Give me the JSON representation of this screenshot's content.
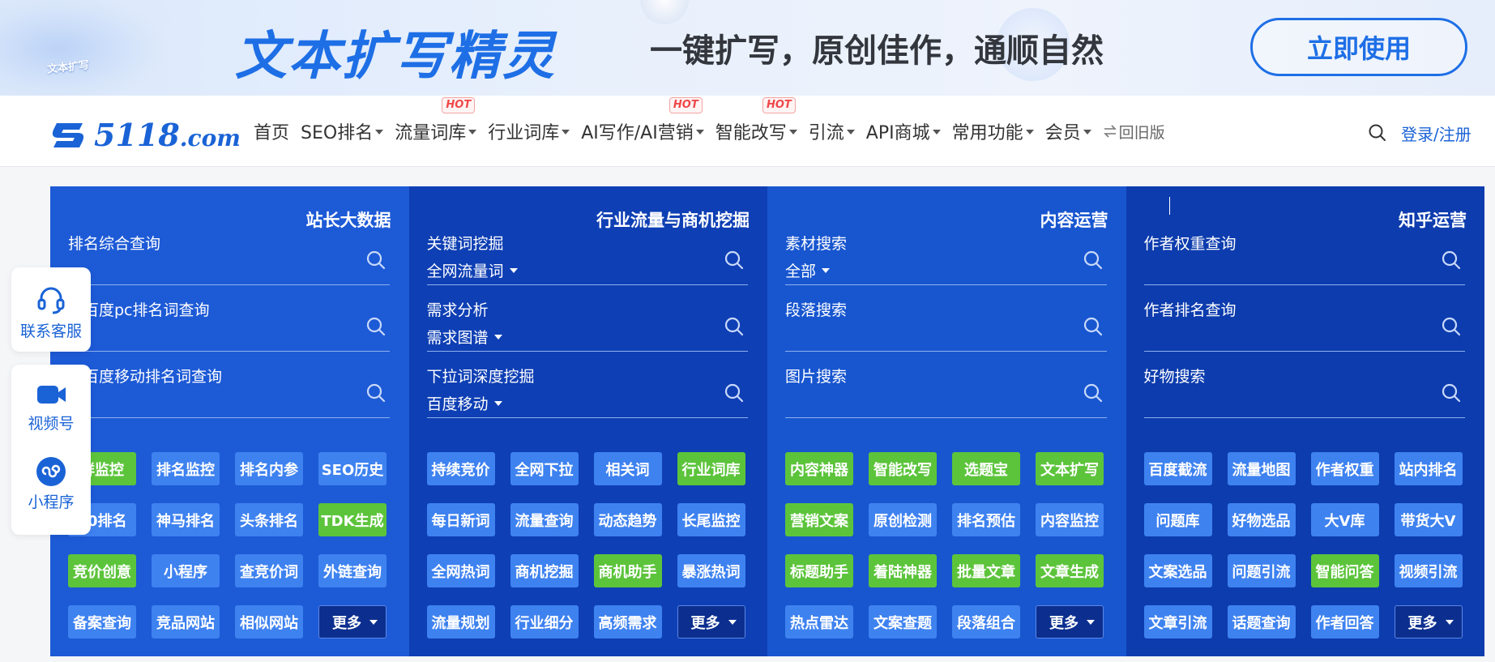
{
  "banner": {
    "small_tag": "文本扩写",
    "title": "文本扩写精灵",
    "slogan": "一键扩写，原创佳作，通顺自然",
    "cta": "立即使用"
  },
  "nav": {
    "logo_text": "5118",
    "logo_domain": ".com",
    "items": [
      {
        "label": "首页",
        "caret": false,
        "hot": ""
      },
      {
        "label": "SEO排名",
        "caret": true,
        "hot": ""
      },
      {
        "label": "流量词库",
        "caret": true,
        "hot": "HOT"
      },
      {
        "label": "行业词库",
        "caret": true,
        "hot": ""
      },
      {
        "label": "AI写作/AI营销",
        "caret": true,
        "hot": "HOT"
      },
      {
        "label": "智能改写",
        "caret": true,
        "hot": "HOT"
      },
      {
        "label": "引流",
        "caret": true,
        "hot": ""
      },
      {
        "label": "API商城",
        "caret": true,
        "hot": ""
      },
      {
        "label": "常用功能",
        "caret": true,
        "hot": ""
      },
      {
        "label": "会员",
        "caret": true,
        "hot": ""
      }
    ],
    "old_version": "回旧版",
    "login": "登录/注册"
  },
  "columns": [
    {
      "title": "站长大数据",
      "fields": [
        {
          "label": "排名综合查询",
          "select": ""
        },
        {
          "label": "站百度pc排名词查询",
          "select": ""
        },
        {
          "label": "站百度移动排名词查询",
          "select": ""
        }
      ],
      "buttons": [
        {
          "label": "鲜监控",
          "style": "green"
        },
        {
          "label": "排名监控",
          "style": "blue"
        },
        {
          "label": "排名内参",
          "style": "blue"
        },
        {
          "label": "SEO历史",
          "style": "blue"
        },
        {
          "label": "60排名",
          "style": "blue"
        },
        {
          "label": "神马排名",
          "style": "blue"
        },
        {
          "label": "头条排名",
          "style": "blue"
        },
        {
          "label": "TDK生成",
          "style": "green"
        },
        {
          "label": "竞价创意",
          "style": "green"
        },
        {
          "label": "小程序",
          "style": "blue"
        },
        {
          "label": "查竞价词",
          "style": "blue"
        },
        {
          "label": "外链查询",
          "style": "blue"
        },
        {
          "label": "备案查询",
          "style": "blue"
        },
        {
          "label": "竞品网站",
          "style": "blue"
        },
        {
          "label": "相似网站",
          "style": "blue"
        },
        {
          "label": "更多",
          "style": "more"
        }
      ]
    },
    {
      "title": "行业流量与商机挖掘",
      "fields": [
        {
          "label": "关键词挖掘",
          "select": "全网流量词"
        },
        {
          "label": "需求分析",
          "select": "需求图谱"
        },
        {
          "label": "下拉词深度挖掘",
          "select": "百度移动"
        }
      ],
      "buttons": [
        {
          "label": "持续竞价",
          "style": "blue"
        },
        {
          "label": "全网下拉",
          "style": "blue"
        },
        {
          "label": "相关词",
          "style": "blue"
        },
        {
          "label": "行业词库",
          "style": "green"
        },
        {
          "label": "每日新词",
          "style": "blue"
        },
        {
          "label": "流量查询",
          "style": "blue"
        },
        {
          "label": "动态趋势",
          "style": "blue"
        },
        {
          "label": "长尾监控",
          "style": "blue"
        },
        {
          "label": "全网热词",
          "style": "blue"
        },
        {
          "label": "商机挖掘",
          "style": "blue"
        },
        {
          "label": "商机助手",
          "style": "green"
        },
        {
          "label": "暴涨热词",
          "style": "blue"
        },
        {
          "label": "流量规划",
          "style": "blue"
        },
        {
          "label": "行业细分",
          "style": "blue"
        },
        {
          "label": "高频需求",
          "style": "blue"
        },
        {
          "label": "更多",
          "style": "more"
        }
      ]
    },
    {
      "title": "内容运营",
      "fields": [
        {
          "label": "素材搜索",
          "select": "全部"
        },
        {
          "label": "段落搜索",
          "select": ""
        },
        {
          "label": "图片搜索",
          "select": ""
        }
      ],
      "buttons": [
        {
          "label": "内容神器",
          "style": "green"
        },
        {
          "label": "智能改写",
          "style": "green"
        },
        {
          "label": "选题宝",
          "style": "green"
        },
        {
          "label": "文本扩写",
          "style": "green"
        },
        {
          "label": "营销文案",
          "style": "green"
        },
        {
          "label": "原创检测",
          "style": "blue"
        },
        {
          "label": "排名预估",
          "style": "blue"
        },
        {
          "label": "内容监控",
          "style": "blue"
        },
        {
          "label": "标题助手",
          "style": "green"
        },
        {
          "label": "着陆神器",
          "style": "green"
        },
        {
          "label": "批量文章",
          "style": "green"
        },
        {
          "label": "文章生成",
          "style": "green"
        },
        {
          "label": "热点雷达",
          "style": "blue"
        },
        {
          "label": "文案查题",
          "style": "blue"
        },
        {
          "label": "段落组合",
          "style": "blue"
        },
        {
          "label": "更多",
          "style": "more"
        }
      ]
    },
    {
      "title": "知乎运营",
      "fields": [
        {
          "label": "作者权重查询",
          "select": ""
        },
        {
          "label": "作者排名查询",
          "select": ""
        },
        {
          "label": "好物搜索",
          "select": ""
        }
      ],
      "buttons": [
        {
          "label": "百度截流",
          "style": "blue"
        },
        {
          "label": "流量地图",
          "style": "blue"
        },
        {
          "label": "作者权重",
          "style": "blue"
        },
        {
          "label": "站内排名",
          "style": "blue"
        },
        {
          "label": "问题库",
          "style": "blue"
        },
        {
          "label": "好物选品",
          "style": "blue"
        },
        {
          "label": "大V库",
          "style": "blue"
        },
        {
          "label": "带货大V",
          "style": "blue"
        },
        {
          "label": "文案选品",
          "style": "blue"
        },
        {
          "label": "问题引流",
          "style": "blue"
        },
        {
          "label": "智能问答",
          "style": "green"
        },
        {
          "label": "视频引流",
          "style": "blue"
        },
        {
          "label": "文章引流",
          "style": "blue"
        },
        {
          "label": "话题查询",
          "style": "blue"
        },
        {
          "label": "作者回答",
          "style": "blue"
        },
        {
          "label": "更多",
          "style": "more"
        }
      ]
    }
  ],
  "side": {
    "service": "联系客服",
    "video": "视频号",
    "mini": "小程序"
  },
  "icons": {
    "search": "search-icon",
    "headset": "headset-icon",
    "video": "video-camera-icon",
    "mini": "mini-program-icon",
    "swap": "swap-icon"
  },
  "colors": {
    "brand": "#1a63d6",
    "green": "#5cc43b",
    "button_blue": "#3e82f0",
    "hot": "#f04848"
  }
}
